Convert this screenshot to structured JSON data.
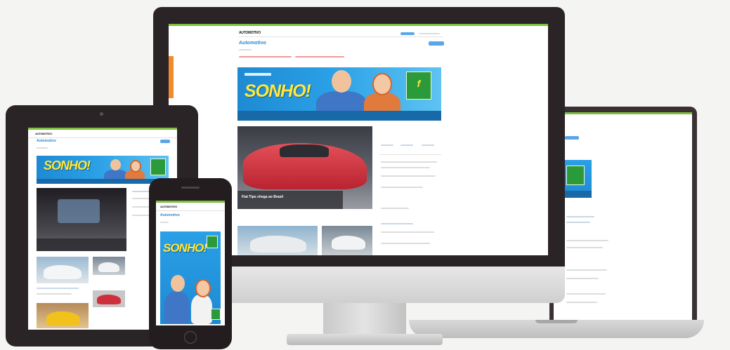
{
  "scene": {
    "description_kind": "responsive-site-mockup",
    "devices": [
      "monitor",
      "tablet",
      "phone",
      "laptop"
    ]
  },
  "site": {
    "logo": "AUTOMOTIVO",
    "section": "Automotivo",
    "banner_headline": "SONHO!",
    "caption": "Fiat Tipo chega ao Brasil"
  },
  "colors": {
    "accent_blue": "#2a8ad6",
    "banner_blue": "#1e8ad3",
    "banner_yellow": "#ffe83a",
    "brand_green": "#2a9a3a",
    "bezel": "#2b2427",
    "car_red": "#d23642"
  }
}
